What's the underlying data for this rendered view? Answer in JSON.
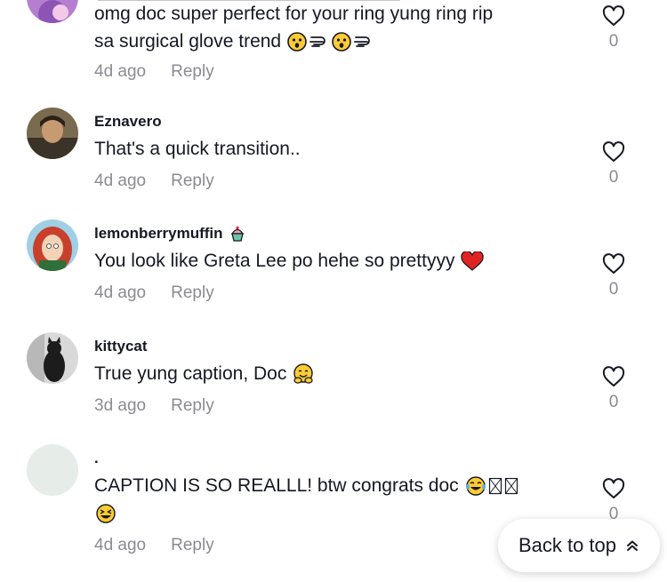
{
  "colors": {
    "text": "#161823",
    "muted": "#8a8b91",
    "heart_red": "#e02424"
  },
  "comments": [
    {
      "username": "",
      "text_line1": "omg doc super perfect for your ring yung ring rip",
      "text_line2": "sa surgical glove trend",
      "time": "4d ago",
      "reply": "Reply",
      "likes": "0",
      "emojis": [
        "astonished-face-emoji",
        "dashing-away-emoji",
        "astonished-face-emoji",
        "dashing-away-emoji"
      ]
    },
    {
      "username": "Eznavero",
      "text": "That's a quick transition..",
      "time": "4d ago",
      "reply": "Reply",
      "likes": "0"
    },
    {
      "username": "lemonberrymuffin",
      "username_badge": "cupcake-emoji",
      "text": "You look like Greta Lee po hehe so prettyyy",
      "text_emoji": "red-heart-emoji",
      "time": "4d ago",
      "reply": "Reply",
      "likes": "0"
    },
    {
      "username": "kittycat",
      "text": "True yung caption, Doc",
      "text_emoji": "hugging-face-emoji",
      "time": "3d ago",
      "reply": "Reply",
      "likes": "0"
    },
    {
      "username": ".",
      "text": "CAPTION IS SO REALLL! btw congrats doc",
      "text_emojis": [
        "tears-of-joy-emoji",
        "missing-glyph",
        "missing-glyph",
        "laughing-face-emoji"
      ],
      "time": "4d ago",
      "reply": "Reply",
      "likes": "0"
    }
  ],
  "back_to_top": {
    "label": "Back to top",
    "icon": "double-chevron-up-icon"
  }
}
